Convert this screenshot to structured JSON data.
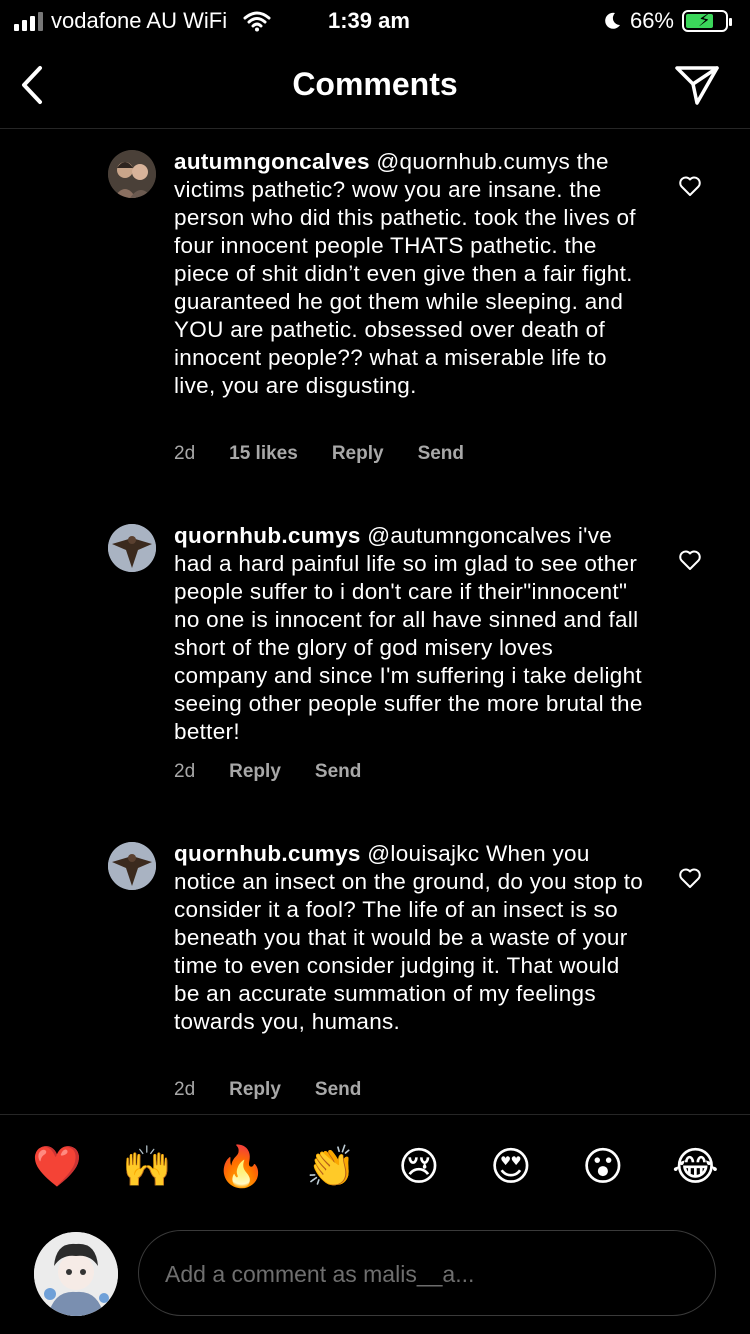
{
  "status_bar": {
    "carrier": "vodafone AU WiFi",
    "time": "1:39 am",
    "battery": "66%"
  },
  "header": {
    "title": "Comments"
  },
  "comments": [
    {
      "username": "autumngoncalves",
      "text": "@quornhub.cumys the victims pathetic? wow you are insane. the person who did this pathetic. took the lives of four innocent people THATS pathetic. the piece of shit didn’t even give then a fair fight. guaranteed he got them while sleeping. and YOU are pathetic. obsessed over death of innocent people?? what a miserable life to live, you are disgusting.",
      "time": "2d",
      "likes": "15 likes",
      "reply": "Reply",
      "send": "Send"
    },
    {
      "username": "quornhub.cumys",
      "text": "@autumngoncalves i've had a hard painful life so im glad to see other people suffer to i don't care if their\"innocent\" no one is innocent for all have sinned and fall short of the glory of god misery loves company and since I'm suffering i take delight seeing other people suffer the more brutal the better!",
      "time": "2d",
      "reply": "Reply",
      "send": "Send"
    },
    {
      "username": "quornhub.cumys",
      "text": "@louisajkc When you notice an insect on the ground, do you stop to consider it a fool? The life of an insect is so beneath you that it would be a waste of your time to even consider judging it. That would be an accurate summation of my feelings towards you, humans.",
      "time": "2d",
      "reply": "Reply",
      "send": "Send"
    }
  ],
  "emoji_bar": [
    "❤️",
    "🙌",
    "🔥",
    "👏",
    "😢",
    "😍",
    "😮",
    "😂"
  ],
  "composer": {
    "placeholder": "Add a comment as malis__a..."
  },
  "colors": {
    "background": "#000000",
    "muted": "#a8a8a8",
    "divider": "#262626",
    "battery": "#3bd65a"
  },
  "icons": [
    "signal-icon",
    "wifi-icon",
    "moon-icon",
    "battery-icon",
    "back-chevron-icon",
    "direct-send-icon",
    "heart-outline-icon"
  ]
}
